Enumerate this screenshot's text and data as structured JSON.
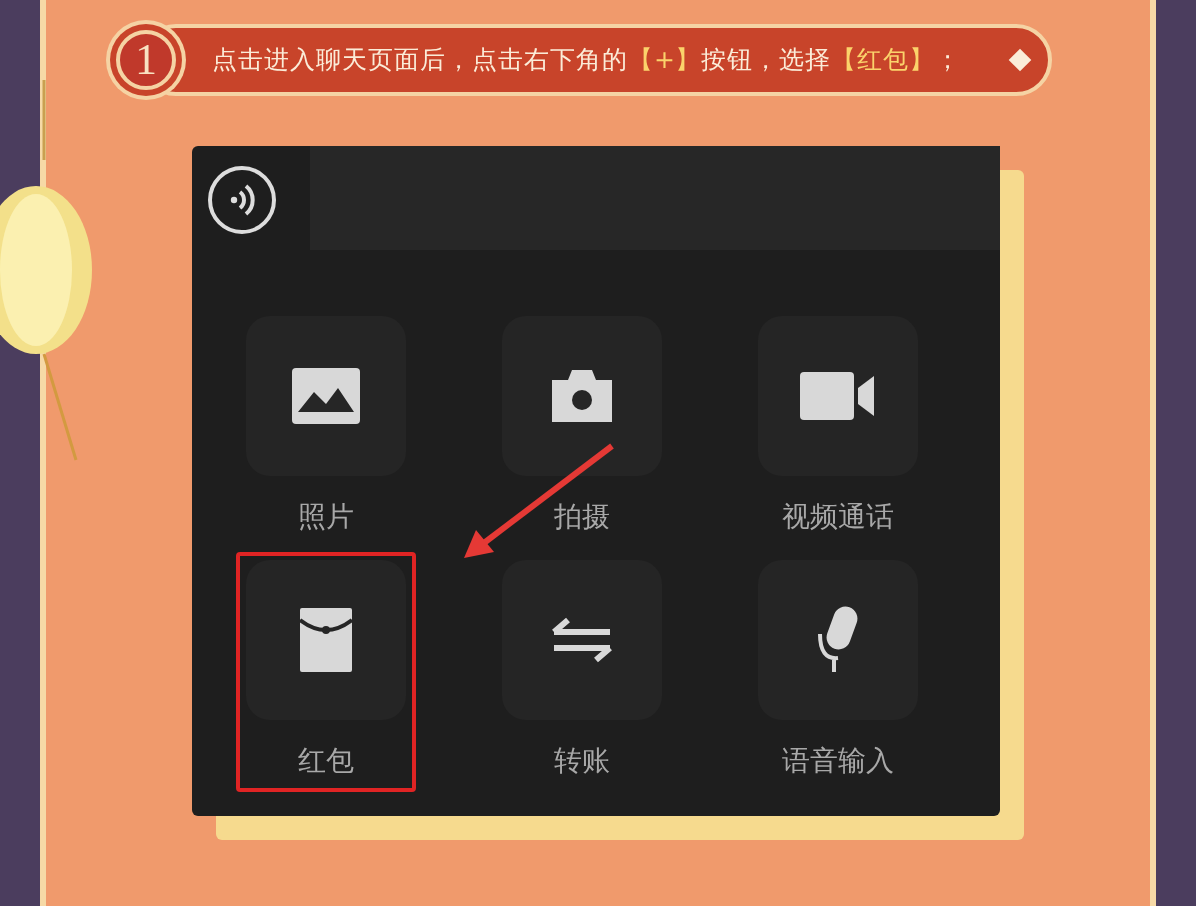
{
  "step": {
    "number": "1",
    "segments": [
      {
        "text": "点击进入聊天页面后，点击右下角的",
        "highlight": false
      },
      {
        "text": "【+】",
        "highlight": true
      },
      {
        "text": "按钮，选择",
        "highlight": false
      },
      {
        "text": "【红包】",
        "highlight": true
      },
      {
        "text": "；",
        "highlight": false
      }
    ]
  },
  "panel": {
    "items": [
      {
        "label": "照片",
        "kind": "photo",
        "selected": false
      },
      {
        "label": "拍摄",
        "kind": "camera",
        "selected": false
      },
      {
        "label": "视频通话",
        "kind": "video",
        "selected": false
      },
      {
        "label": "红包",
        "kind": "envelope",
        "selected": true
      },
      {
        "label": "转账",
        "kind": "transfer",
        "selected": false
      },
      {
        "label": "语音输入",
        "kind": "mic",
        "selected": false
      }
    ]
  }
}
